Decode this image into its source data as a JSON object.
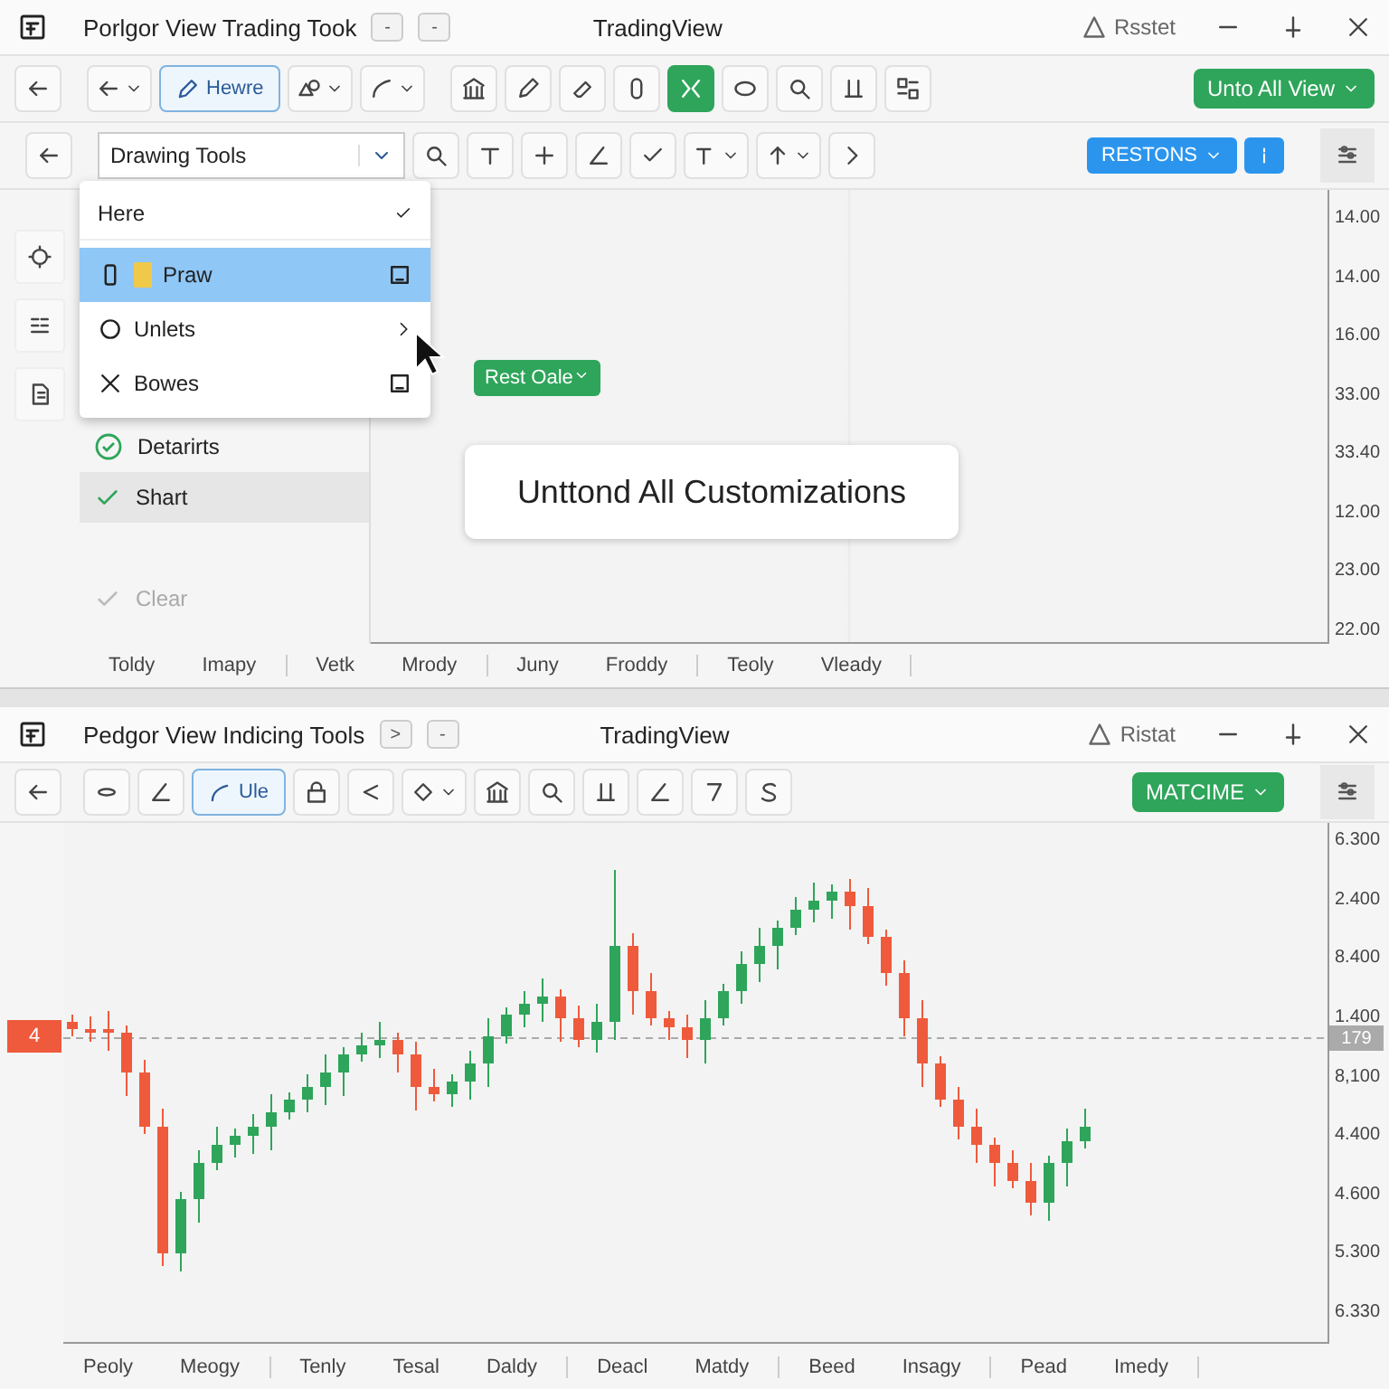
{
  "top_window": {
    "title_bar": {
      "title": "Porlgor View Trading Took",
      "small_buttons": [
        "-",
        "-"
      ],
      "center_title": "TradingView",
      "reset": "Rsstet"
    },
    "toolbar": {
      "view_button": {
        "label": "Hewre",
        "selected": true
      },
      "tools": [
        {
          "selected": false
        },
        {
          "selected": false
        },
        {
          "selected": false
        },
        {
          "selected": false
        },
        {
          "selected": true
        },
        {
          "selected": false
        },
        {
          "selected": false
        },
        {
          "selected": false
        },
        {
          "selected": false
        }
      ],
      "primary_button": "Unto All View"
    },
    "drawing_bar": {
      "dropdown": "Drawing Tools",
      "blue_button": "RESTONS"
    },
    "menu": [
      {
        "label": "Here",
        "kind": "check",
        "selected": false
      },
      {
        "label": "Praw",
        "kind": "file",
        "selected": true
      },
      {
        "label": "Unlets",
        "kind": "submenu",
        "selected": false
      },
      {
        "label": "Bowes",
        "kind": "close",
        "selected": false
      }
    ],
    "sidebar": [
      {
        "label": "Detarirts",
        "kind": "circle-check",
        "selected": false,
        "disabled": false
      },
      {
        "label": "Shart",
        "kind": "check",
        "selected": true,
        "disabled": false
      },
      {
        "label": "Clear",
        "kind": "check",
        "selected": false,
        "disabled": true
      }
    ],
    "chip": "Rest Oale",
    "card": "Unttond All Customizations",
    "y_axis": [
      "14.00",
      "14.00",
      "16.00",
      "33.00",
      "33.40",
      "12.00",
      "23.00",
      "22.00"
    ],
    "x_axis": [
      {
        "labels": [
          "Toldy",
          "Imapy"
        ]
      },
      {
        "labels": [
          "Vetk",
          "Mrody"
        ]
      },
      {
        "labels": [
          "Juny",
          "Froddy"
        ]
      },
      {
        "labels": [
          "Teoly",
          "Vleady"
        ]
      }
    ]
  },
  "bottom_window": {
    "title_bar": {
      "title": "Pedgor View Indicing Tools",
      "small_buttons": [
        ">",
        "-"
      ],
      "center_title": "TradingView",
      "reset": "Ristat"
    },
    "toolbar": {
      "view_button": {
        "label": "Ule",
        "selected": true
      },
      "tools": [
        {
          "selected": false
        },
        {
          "selected": false
        },
        {
          "selected": false
        },
        {
          "selected": false
        },
        {
          "selected": false
        },
        {
          "selected": false
        },
        {
          "selected": false
        },
        {
          "selected": false
        },
        {
          "selected": false
        }
      ],
      "primary_button": "MATCIME"
    },
    "price_marker": "4",
    "price_label": "179",
    "y_axis": [
      "6.300",
      "2.400",
      "8.400",
      "1.400",
      "8,100",
      "4.400",
      "4.600",
      "5.300",
      "6.330"
    ],
    "x_axis": [
      {
        "labels": [
          "Peoly",
          "Meogy"
        ]
      },
      {
        "labels": [
          "Tenly",
          "Tesal",
          "Daldy"
        ]
      },
      {
        "labels": [
          "Deacl",
          "Matdy"
        ]
      },
      {
        "labels": [
          "Beed",
          "Insagy"
        ]
      },
      {
        "labels": [
          "Pead",
          "Imedy"
        ]
      }
    ]
  }
}
